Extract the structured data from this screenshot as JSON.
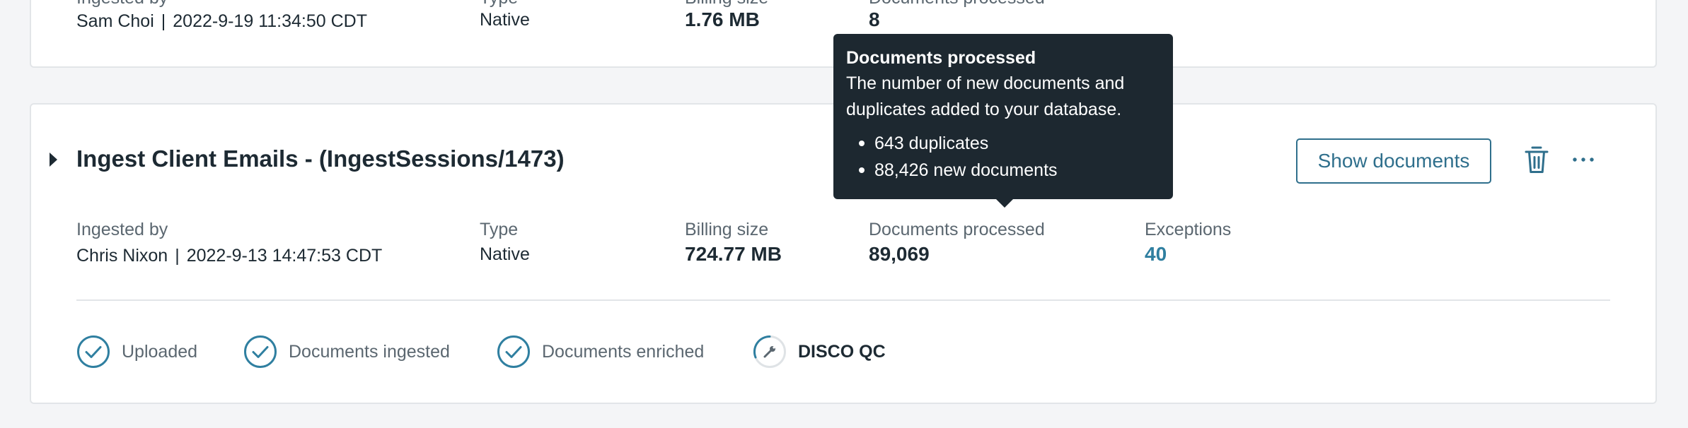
{
  "top_session": {
    "ingested_by_label": "Ingested by",
    "ingested_by": "Sam Choi",
    "ingested_at": "2022-9-19 11:34:50 CDT",
    "type_label": "Type",
    "type": "Native",
    "billing_size_label": "Billing size",
    "billing_size": "1.76 MB",
    "documents_processed_label": "Documents processed",
    "documents_processed": "8"
  },
  "session": {
    "title": "Ingest Client Emails - (IngestSessions/1473)",
    "show_documents_label": "Show documents",
    "ingested_by_label": "Ingested by",
    "ingested_by": "Chris Nixon",
    "ingested_at": "2022-9-13 14:47:53 CDT",
    "separator": "|",
    "type_label": "Type",
    "type": "Native",
    "billing_size_label": "Billing size",
    "billing_size": "724.77 MB",
    "documents_processed_label": "Documents processed",
    "documents_processed": "89,069",
    "exceptions_label": "Exceptions",
    "exceptions": "40",
    "steps": [
      {
        "label": "Uploaded",
        "status": "complete",
        "icon": "check-circle-icon"
      },
      {
        "label": "Documents ingested",
        "status": "complete",
        "icon": "check-circle-icon"
      },
      {
        "label": "Documents enriched",
        "status": "complete",
        "icon": "check-circle-icon"
      },
      {
        "label": "DISCO QC",
        "status": "in-progress",
        "icon": "wrench-progress-icon"
      }
    ]
  },
  "tooltip": {
    "title": "Documents processed",
    "body": "The number of new documents and duplicates added to your database.",
    "items": [
      "643 duplicates",
      "88,426 new documents"
    ]
  },
  "colors": {
    "accent": "#2f7fa0",
    "button_border": "#2f6f8c",
    "tooltip_bg": "#1d2830",
    "background": "#f4f5f7"
  }
}
